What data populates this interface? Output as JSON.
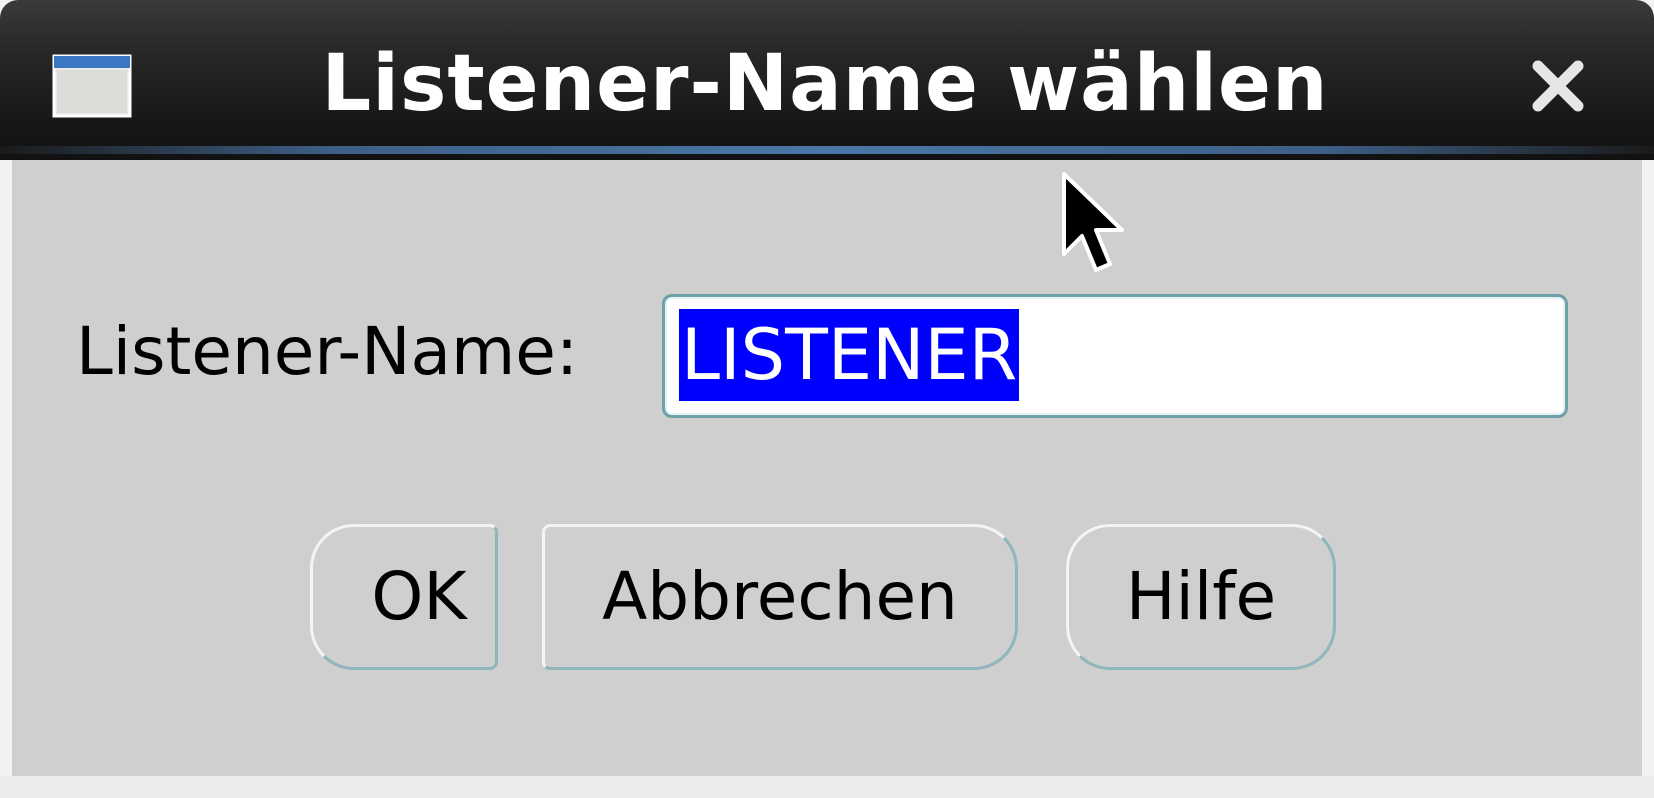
{
  "window": {
    "title": "Listener-Name wählen",
    "icon": "window-icon",
    "close_icon": "close-icon"
  },
  "form": {
    "label": "Listener-Name:",
    "value": "LISTENER",
    "value_selected": true
  },
  "buttons": {
    "ok": "OK",
    "cancel": "Abbrechen",
    "help": "Hilfe"
  },
  "colors": {
    "titlebar": "#1c1c1c",
    "dialog_bg": "#cfcfcf",
    "selection_bg": "#0000ff",
    "selection_text": "#ffffff",
    "focus_border": "#6aa0a6"
  }
}
